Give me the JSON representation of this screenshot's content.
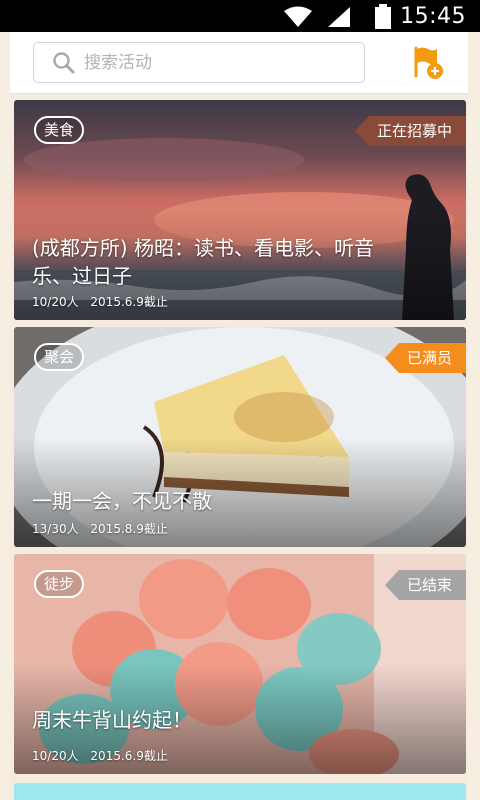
{
  "status_bar": {
    "time": "15:45",
    "icons": [
      "wifi-icon",
      "signal-icon",
      "battery-icon"
    ]
  },
  "search": {
    "placeholder": "搜索活动"
  },
  "colors": {
    "accent": "#f39c12",
    "status_recruiting": "#8a4a3a",
    "status_full": "#f58c1e",
    "status_ended": "#a5a5a5"
  },
  "activities": [
    {
      "category": "美食",
      "status": "正在招募中",
      "title": "(成都方所) 杨昭：读书、看电影、听音乐、过日子",
      "people": "10/20人",
      "deadline": "2015.6.9截止"
    },
    {
      "category": "聚会",
      "status": "已满员",
      "title": "一期一会，不见不散",
      "people": "13/30人",
      "deadline": "2015.8.9截止"
    },
    {
      "category": "徒步",
      "status": "已结束",
      "title": "周末牛背山约起！",
      "people": "10/20人",
      "deadline": "2015.6.9截止"
    }
  ]
}
